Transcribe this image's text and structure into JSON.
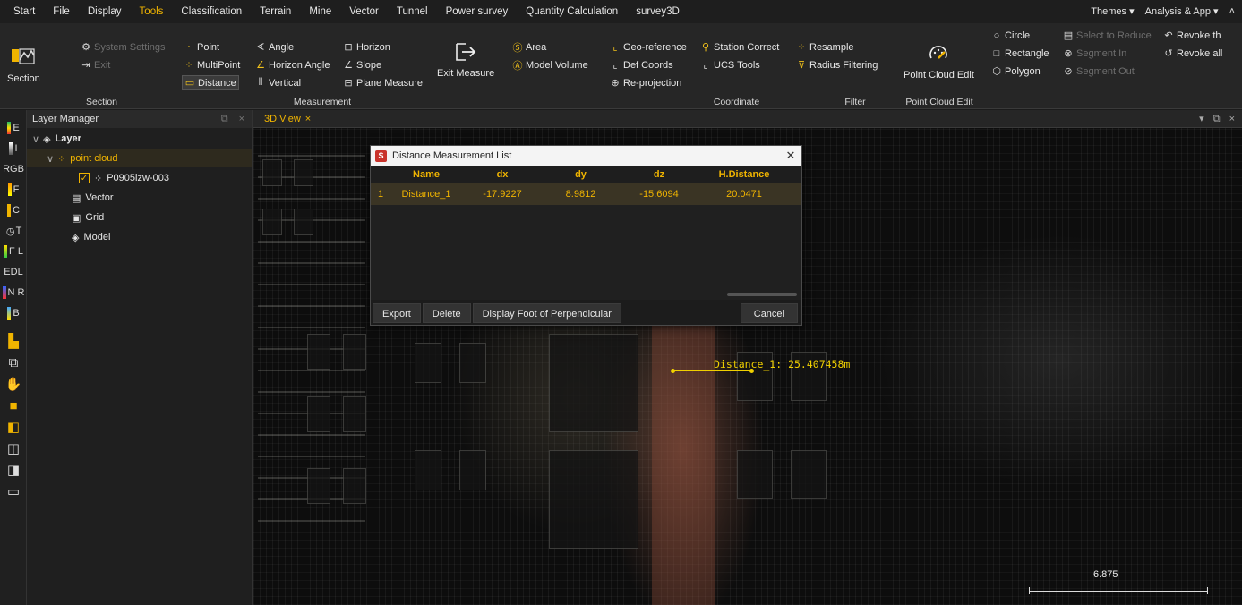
{
  "menubar": {
    "items": [
      "Start",
      "File",
      "Display",
      "Tools",
      "Classification",
      "Terrain",
      "Mine",
      "Vector",
      "Tunnel",
      "Power survey",
      "Quantity Calculation",
      "survey3D"
    ],
    "active": "Tools",
    "themes": "Themes ▾",
    "analysis": "Analysis & App ▾",
    "collapse": "˄"
  },
  "ribbon": {
    "section": {
      "button": "Section",
      "group": "Section"
    },
    "system": {
      "settings": "System Settings",
      "exit": "Exit"
    },
    "measurement": {
      "point": "Point",
      "multipoint": "MultiPoint",
      "distance": "Distance",
      "angle": "Angle",
      "horizon_angle": "Horizon Angle",
      "vertical": "Vertical",
      "horizon": "Horizon",
      "slope": "Slope",
      "plane_measure": "Plane Measure",
      "exit_measure": "Exit Measure",
      "area": "Area",
      "model_volume": "Model Volume",
      "group": "Measurement"
    },
    "coordinate": {
      "geo_reference": "Geo-reference",
      "def_coords": "Def Coords",
      "re_projection": "Re-projection",
      "station_correct": "Station Correct",
      "ucs_tools": "UCS Tools",
      "group": "Coordinate"
    },
    "filter": {
      "resample": "Resample",
      "radius_filtering": "Radius Filtering",
      "group": "Filter"
    },
    "edit": {
      "point_cloud_edit": "Point Cloud Edit",
      "group": "Point Cloud Edit",
      "circle": "Circle",
      "rectangle": "Rectangle",
      "polygon": "Polygon",
      "select_to_reduce": "Select to Reduce",
      "segment_in": "Segment In",
      "segment_out": "Segment Out",
      "revoke_the": "Revoke th",
      "revoke_all": "Revoke all"
    }
  },
  "left_tools": [
    "E",
    "I",
    "RGB",
    "F",
    "C",
    "T",
    "F L",
    "EDL",
    "N R",
    "B"
  ],
  "layer_manager": {
    "title": "Layer Manager",
    "root": "Layer",
    "point_cloud": "point cloud",
    "file": "P0905lzw-003",
    "vector": "Vector",
    "grid": "Grid",
    "model": "Model"
  },
  "view": {
    "tab": "3D View",
    "measure_label": "Distance_1: 25.407458m",
    "scale": "6.875"
  },
  "dialog": {
    "title": "Distance Measurement List",
    "columns": [
      "Name",
      "dx",
      "dy",
      "dz",
      "H.Distance"
    ],
    "rows": [
      {
        "index": "1",
        "name": "Distance_1",
        "dx": "-17.9227",
        "dy": "8.9812",
        "dz": "-15.6094",
        "hdist": "20.0471"
      }
    ],
    "buttons": {
      "export": "Export",
      "delete": "Delete",
      "foot": "Display Foot of Perpendicular",
      "cancel": "Cancel"
    }
  }
}
